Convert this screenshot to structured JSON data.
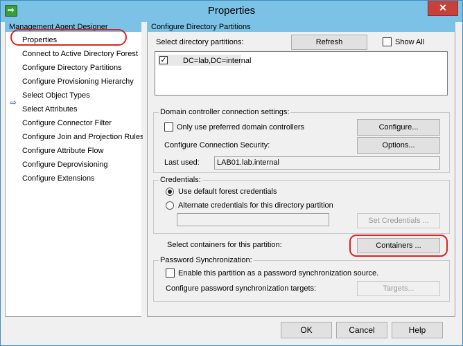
{
  "window": {
    "title": "Properties",
    "close_label": "✕",
    "icon_label": "⇨"
  },
  "left_pane": {
    "header": "Management Agent Designer",
    "items": [
      {
        "label": "Properties"
      },
      {
        "label": "Connect to Active Directory Forest"
      },
      {
        "label": "Configure Directory Partitions",
        "selected": true
      },
      {
        "label": "Configure Provisioning Hierarchy"
      },
      {
        "label": "Select Object Types"
      },
      {
        "label": "Select Attributes"
      },
      {
        "label": "Configure Connector Filter"
      },
      {
        "label": "Configure Join and Projection Rules"
      },
      {
        "label": "Configure Attribute Flow"
      },
      {
        "label": "Configure Deprovisioning"
      },
      {
        "label": "Configure Extensions"
      }
    ],
    "selected_arrow": "⇨"
  },
  "right_pane": {
    "header": "Configure Directory Partitions",
    "select_partitions_label": "Select directory partitions:",
    "refresh_label": "Refresh",
    "show_all_label": "Show All",
    "partitions": [
      {
        "label": "DC=lab,DC=internal",
        "checked": true
      }
    ],
    "check_mark": "✓",
    "dc_group": {
      "title": "Domain controller connection settings:",
      "preferred_label": "Only use preferred domain controllers",
      "configure_label": "Configure...",
      "security_label": "Configure Connection Security:",
      "options_label": "Options...",
      "last_used_label": "Last used:",
      "last_used_value": "LAB01.lab.internal"
    },
    "credentials_group": {
      "title": "Credentials:",
      "default_label": "Use default forest credentials",
      "alternate_label": "Alternate credentials for this directory partition",
      "alternate_value": "",
      "set_credentials_label": "Set Credentials ..."
    },
    "containers_label": "Select containers for this partition:",
    "containers_button": "Containers ...",
    "password_group": {
      "title": "Password Synchronization:",
      "enable_label": "Enable this partition as a password synchronization source.",
      "targets_label": "Configure password synchronization targets:",
      "targets_button": "Targets..."
    }
  },
  "footer": {
    "ok": "OK",
    "cancel": "Cancel",
    "help": "Help"
  },
  "colors": {
    "titlebar": "#7bc2e6",
    "close": "#c7413a",
    "highlight": "#dd2222"
  }
}
